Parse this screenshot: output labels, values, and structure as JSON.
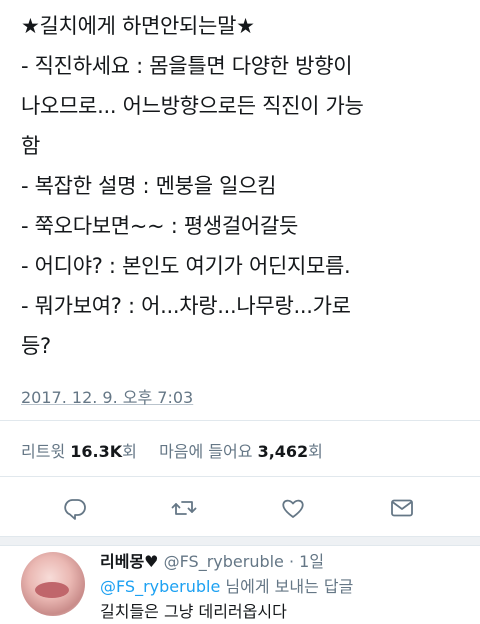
{
  "tweet": {
    "lines": [
      "★길치에게 하면안되는말★",
      "- 직진하세요 : 몸을틀면 다양한 방향이",
      "나오므로... 어느방향으로든 직진이 가능",
      "함",
      "- 복잡한 설명 : 멘붕을 일으킴",
      "- 쭉오다보면~~ : 평생걸어갈듯",
      "- 어디야? : 본인도 여기가 어딘지모름.",
      "- 뭐가보여? : 어...차랑...나무랑...가로",
      "등?"
    ],
    "timestamp": "2017. 12. 9. 오후 7:03"
  },
  "stats": {
    "retweet_label": "리트윗",
    "retweet_count": "16.3K",
    "retweet_unit": "회",
    "like_label": "마음에 들어요",
    "like_count": "3,462",
    "like_unit": "회"
  },
  "actions": [
    {
      "name": "reply-icon"
    },
    {
      "name": "retweet-icon"
    },
    {
      "name": "like-heart-icon"
    },
    {
      "name": "share-mail-icon"
    }
  ],
  "reply": {
    "name": "리베몽♥",
    "handle": "@FS_ryberuble",
    "age": "1일",
    "to_mention": "@FS_ryberuble",
    "to_suffix": " 님에게 보내는 답글",
    "text": "길치들은 그냥 데리러옵시다"
  },
  "colors": {
    "text": "#14171a",
    "secondary": "#657786",
    "link": "#1da1f2",
    "divider": "#e1e8ed"
  }
}
